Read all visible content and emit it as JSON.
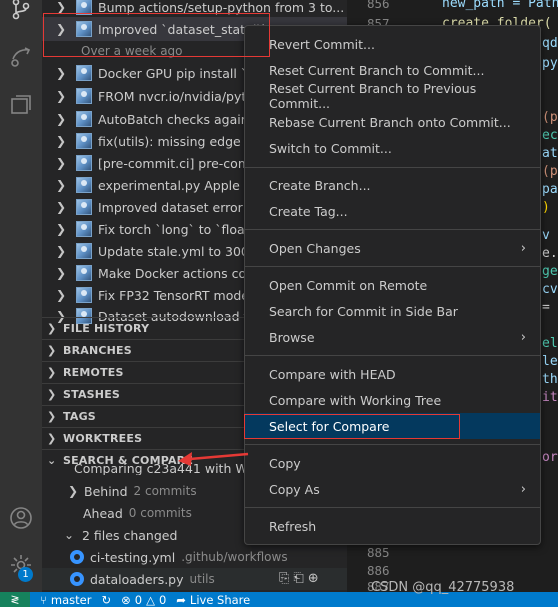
{
  "commits": [
    {
      "message": "Bump actions/setup-python from 3 to..."
    },
    {
      "message": "Improved `dataset_stats()` ..."
    },
    {
      "message": "Docker GPU pip install `opt..."
    },
    {
      "message": "FROM nvcr.io/nvidia/pytorch..."
    },
    {
      "message": "AutoBatch checks against..."
    },
    {
      "message": "fix(utils): missing edge wh..."
    },
    {
      "message": "[pre-commit.ci] pre-commit..."
    },
    {
      "message": "experimental.py Apple MPS..."
    },
    {
      "message": "Improved dataset error in..."
    },
    {
      "message": "Fix torch `long` to `float` t..."
    },
    {
      "message": "Update stale.yml to 300 da..."
    },
    {
      "message": "Make Docker actions cond..."
    },
    {
      "message": "Fix FP32 TensorRT model e..."
    },
    {
      "message": "Dataset autodownload fct..."
    }
  ],
  "selected_commit_time": "Over a week ago",
  "sections": {
    "file_history": "FILE HISTORY",
    "branches": "BRANCHES",
    "remotes": "REMOTES",
    "stashes": "STASHES",
    "tags": "TAGS",
    "worktrees": "WORKTREES",
    "search_compare": "SEARCH & COMPARE"
  },
  "compare": {
    "header": "Comparing c23a441 with Wor...",
    "behind_label": "Behind",
    "behind_count": "2 commits",
    "ahead_label": "Ahead",
    "ahead_count": "0 commits",
    "files_changed": "2 files changed",
    "files": [
      {
        "name": "ci-testing.yml",
        "path": ".github/workflows"
      },
      {
        "name": "dataloaders.py",
        "path": "utils"
      }
    ]
  },
  "context_menu": {
    "group1": [
      "Revert Commit...",
      "Reset Current Branch to Commit...",
      "Reset Current Branch to Previous Commit...",
      "Rebase Current Branch onto Commit...",
      "Switch to Commit..."
    ],
    "group2": [
      "Create Branch...",
      "Create Tag..."
    ],
    "group3": [
      "Open Changes"
    ],
    "group4": [
      "Open Commit on Remote",
      "Search for Commit in Side Bar",
      "Browse"
    ],
    "group5": [
      "Compare with HEAD",
      "Compare with Working Tree",
      "Select for Compare"
    ],
    "group6": [
      "Copy",
      "Copy As"
    ],
    "group7": [
      "Refresh"
    ]
  },
  "editor": {
    "line_numbers": [
      "856",
      "857",
      "885",
      "886",
      "887"
    ],
    "code_fragments": [
      "new_path = Path",
      "create_folder(",
      "qd",
      "py",
      "(p",
      "ec",
      "at",
      "(p",
      "pa",
      ")",
      "v",
      "e.",
      "ge",
      "cv",
      "=",
      "el",
      "le",
      "th",
      "it",
      "or"
    ]
  },
  "status_bar": {
    "branch": "master",
    "errors": "0",
    "warnings": "0",
    "live_share": "Live Share"
  },
  "badge_count": "1",
  "watermark": "CSDN @qq_42775938",
  "colors": {
    "activity_bar": "#333333",
    "sidebar": "#252526",
    "status_bar": "#007acc",
    "menu_highlight": "#04395e",
    "annotation_red": "#e53935"
  }
}
